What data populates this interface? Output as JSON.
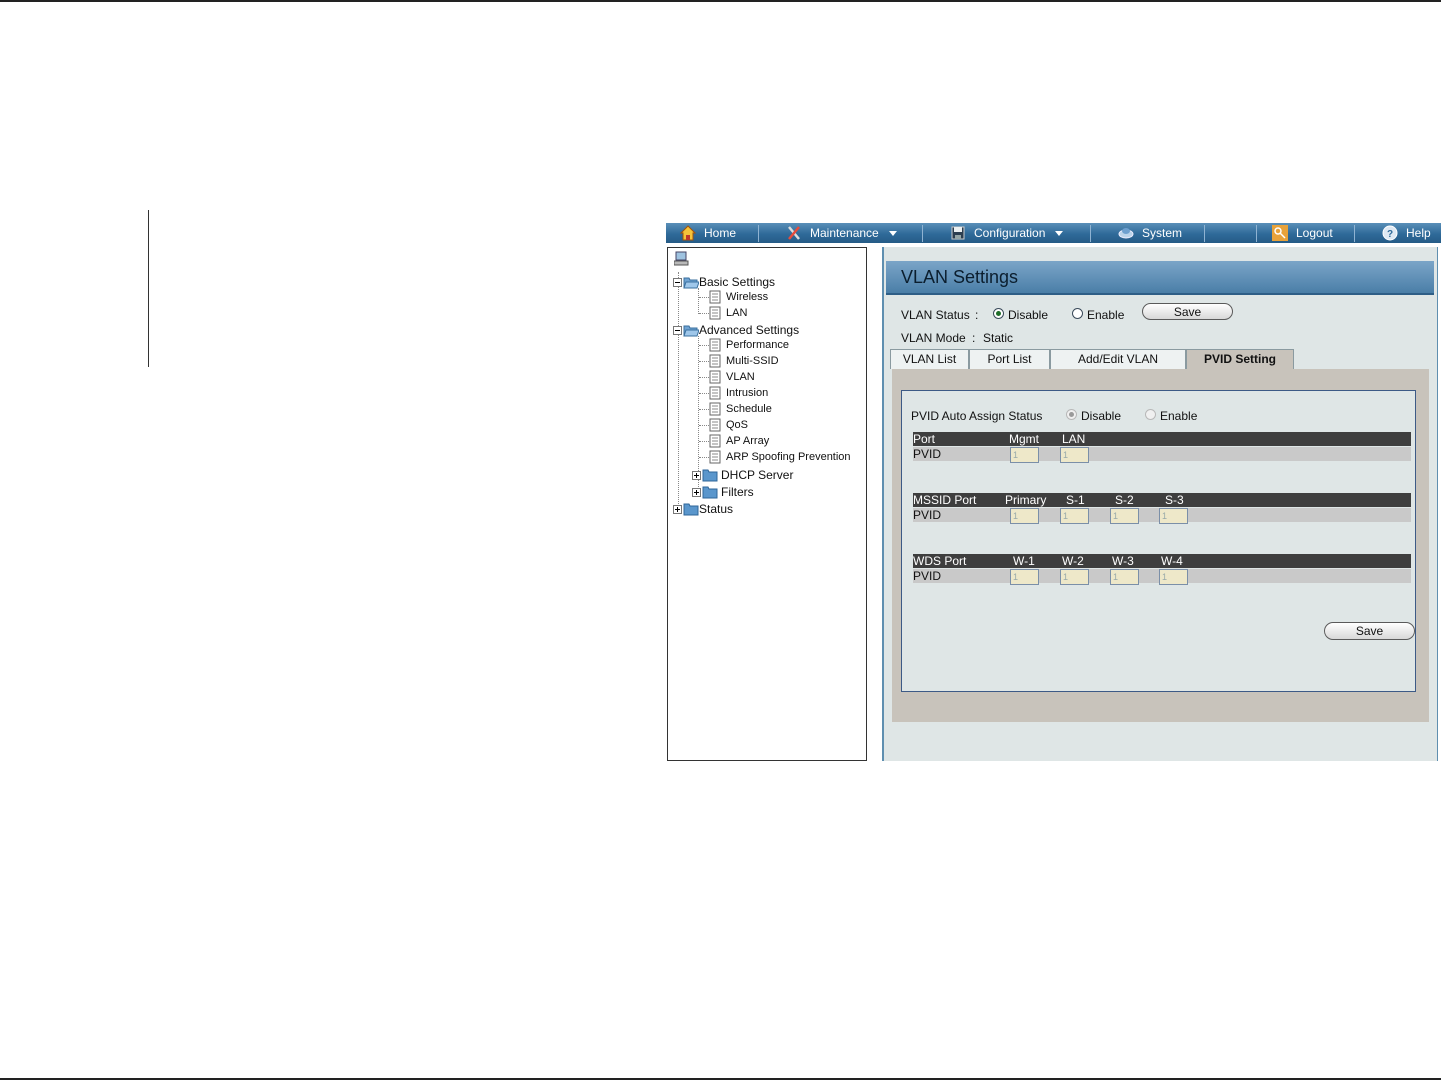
{
  "menu": {
    "items": [
      {
        "label": "Home",
        "icon": "home-icon"
      },
      {
        "label": "Maintenance",
        "icon": "tools-icon"
      },
      {
        "label": "Configuration",
        "icon": "floppy-icon"
      },
      {
        "label": "System",
        "icon": "system-icon"
      },
      {
        "label": "Logout",
        "icon": "key-icon"
      },
      {
        "label": "Help",
        "icon": "help-icon"
      }
    ]
  },
  "tree": {
    "basic_settings": "Basic Settings",
    "basic_children": [
      "Wireless",
      "LAN"
    ],
    "advanced_settings": "Advanced Settings",
    "advanced_children": [
      "Performance",
      "Multi-SSID",
      "VLAN",
      "Intrusion",
      "Schedule",
      "QoS",
      "AP Array",
      "ARP Spoofing Prevention"
    ],
    "dhcp_server": "DHCP Server",
    "filters": "Filters",
    "status": "Status"
  },
  "vlan": {
    "title": "VLAN Settings",
    "status_label": "VLAN Status",
    "colon": ":",
    "disable": "Disable",
    "enable": "Enable",
    "status_value": "Disable",
    "save": "Save",
    "mode_label": "VLAN Mode",
    "mode_value": "Static"
  },
  "tabs": [
    "VLAN List",
    "Port List",
    "Add/Edit VLAN",
    "PVID Setting"
  ],
  "active_tab": "PVID Setting",
  "pvid": {
    "auto_assign_label": "PVID Auto Assign Status",
    "disable": "Disable",
    "enable": "Enable",
    "selected": "Disable",
    "port_table": {
      "header": [
        "Port",
        "Mgmt",
        "LAN"
      ],
      "row_label": "PVID",
      "values": [
        "1",
        "1"
      ]
    },
    "mssid_table": {
      "header": [
        "MSSID Port",
        "Primary",
        "S-1",
        "S-2",
        "S-3"
      ],
      "row_label": "PVID",
      "values": [
        "1",
        "1",
        "1",
        "1"
      ]
    },
    "wds_table": {
      "header": [
        "WDS Port",
        "W-1",
        "W-2",
        "W-3",
        "W-4"
      ],
      "row_label": "PVID",
      "values": [
        "1",
        "1",
        "1",
        "1"
      ]
    },
    "save": "Save"
  }
}
